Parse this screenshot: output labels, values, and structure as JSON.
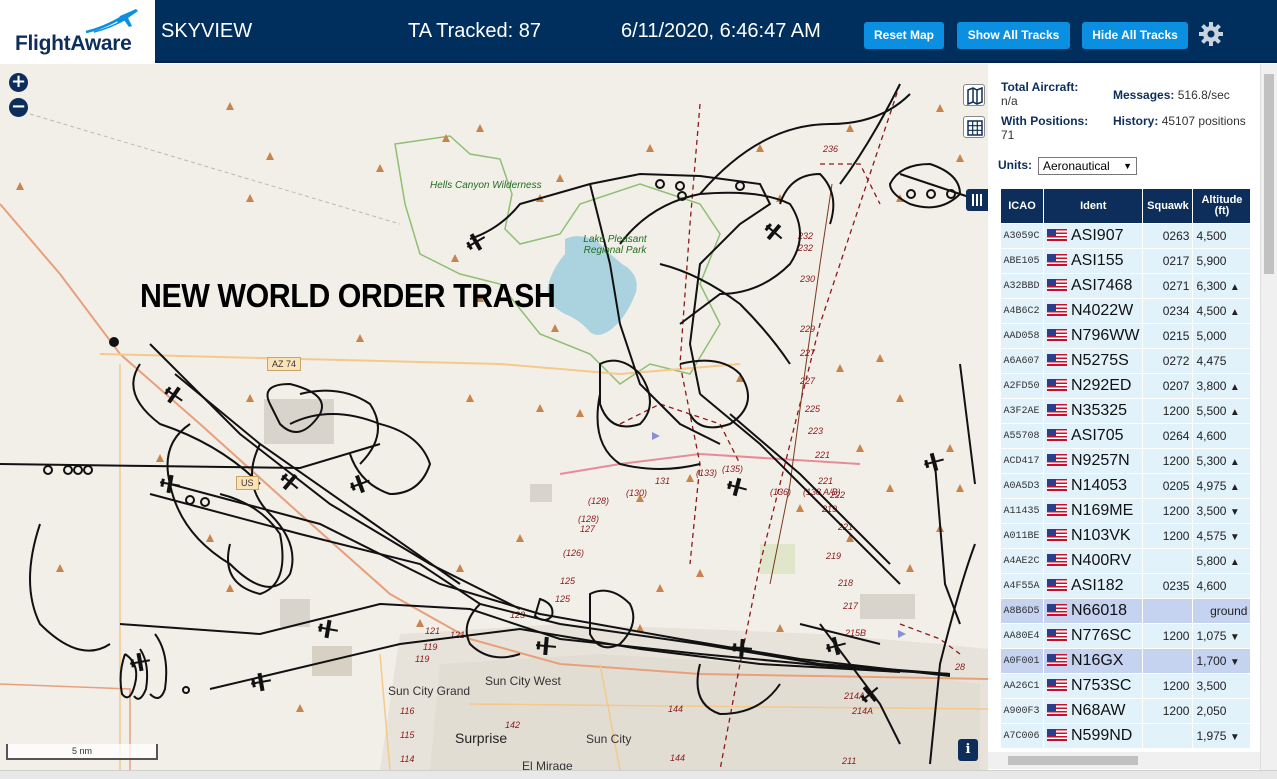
{
  "header": {
    "logo_text": "FlightAware",
    "app_name": "SKYVIEW",
    "ta_tracked": "TA Tracked: 87",
    "datetime": "6/11/2020, 6:46:47 AM",
    "reset_map": "Reset Map",
    "show_all_tracks": "Show All Tracks",
    "hide_all_tracks": "Hide All Tracks",
    "settings_icon": "gear-icon"
  },
  "map": {
    "zoom_in": "+",
    "zoom_out": "−",
    "overlay_text": "NEW WORLD ORDER TRASH",
    "scale_label": "5 nm",
    "info_label": "i",
    "labels": {
      "hells_canyon": "Hells Canyon Wilderness",
      "lake_pleasant": "Lake Pleasant Regional Park",
      "az74": "AZ 74",
      "us60": "US",
      "sun_city_grand": "Sun City Grand",
      "sun_city_west": "Sun City West",
      "sun_city": "Sun City",
      "surprise": "Surprise",
      "el_mirage": "El Mirage"
    },
    "colors": {
      "land": "#f2efe9",
      "water": "#aad3df",
      "park_border": "#8fbf72",
      "track": "#000000",
      "airspace": "#8b1a1a"
    }
  },
  "panel": {
    "total_aircraft_label": "Total Aircraft:",
    "total_aircraft_value": "n/a",
    "messages_label": "Messages:",
    "messages_value": "516.8/sec",
    "with_positions_label": "With Positions:",
    "with_positions_value": "71",
    "history_label": "History:",
    "history_value": "45107 positions",
    "units_label": "Units:",
    "units_value": "Aeronautical",
    "columns": [
      "ICAO",
      "Ident",
      "Squawk",
      "Altitude (ft)"
    ],
    "rows": [
      {
        "icao": "A3059C",
        "ident": "ASI907",
        "squawk": "0263",
        "alt": "4,500",
        "trend": ""
      },
      {
        "icao": "ABE105",
        "ident": "ASI155",
        "squawk": "0217",
        "alt": "5,900",
        "trend": ""
      },
      {
        "icao": "A32BBD",
        "ident": "ASI7468",
        "squawk": "0271",
        "alt": "6,300",
        "trend": "▲"
      },
      {
        "icao": "A4B6C2",
        "ident": "N4022W",
        "squawk": "0234",
        "alt": "4,500",
        "trend": "▲"
      },
      {
        "icao": "AAD058",
        "ident": "N796WW",
        "squawk": "0215",
        "alt": "5,000",
        "trend": ""
      },
      {
        "icao": "A6A607",
        "ident": "N5275S",
        "squawk": "0272",
        "alt": "4,475",
        "trend": ""
      },
      {
        "icao": "A2FD50",
        "ident": "N292ED",
        "squawk": "0207",
        "alt": "3,800",
        "trend": "▲"
      },
      {
        "icao": "A3F2AE",
        "ident": "N35325",
        "squawk": "1200",
        "alt": "5,500",
        "trend": "▲"
      },
      {
        "icao": "A55708",
        "ident": "ASI705",
        "squawk": "0264",
        "alt": "4,600",
        "trend": ""
      },
      {
        "icao": "ACD417",
        "ident": "N9257N",
        "squawk": "1200",
        "alt": "5,300",
        "trend": "▲"
      },
      {
        "icao": "A0A5D3",
        "ident": "N14053",
        "squawk": "0205",
        "alt": "4,975",
        "trend": "▲"
      },
      {
        "icao": "A11435",
        "ident": "N169ME",
        "squawk": "1200",
        "alt": "3,500",
        "trend": "▼"
      },
      {
        "icao": "A011BE",
        "ident": "N103VK",
        "squawk": "1200",
        "alt": "4,575",
        "trend": "▼"
      },
      {
        "icao": "A4AE2C",
        "ident": "N400RV",
        "squawk": "",
        "alt": "5,800",
        "trend": "▲"
      },
      {
        "icao": "A4F55A",
        "ident": "ASI182",
        "squawk": "0235",
        "alt": "4,600",
        "trend": ""
      },
      {
        "icao": "A8B6D5",
        "ident": "N66018",
        "squawk": "",
        "alt": "ground",
        "trend": "",
        "selected": true
      },
      {
        "icao": "AA80E4",
        "ident": "N776SC",
        "squawk": "1200",
        "alt": "1,075",
        "trend": "▼"
      },
      {
        "icao": "A0F001",
        "ident": "N16GX",
        "squawk": "",
        "alt": "1,700",
        "trend": "▼",
        "selected": true
      },
      {
        "icao": "AA26C1",
        "ident": "N753SC",
        "squawk": "1200",
        "alt": "3,500",
        "trend": ""
      },
      {
        "icao": "A900F3",
        "ident": "N68AW",
        "squawk": "1200",
        "alt": "2,050",
        "trend": ""
      },
      {
        "icao": "A7C006",
        "ident": "N599ND",
        "squawk": "",
        "alt": "1,975",
        "trend": "▼"
      }
    ]
  }
}
